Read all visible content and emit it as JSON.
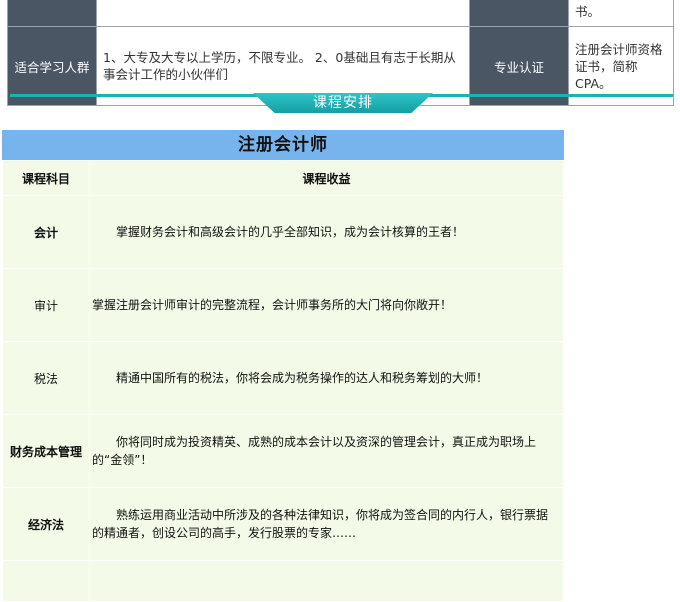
{
  "info_table": {
    "rows": [
      {
        "label_left": "",
        "value_left": "",
        "label_right": "",
        "value_right": "书。"
      },
      {
        "label_left": "适合学习人群",
        "value_left": "1、大专及大专以上学历，不限专业。 2、0基础且有志于长期从事会计工作的小伙伴们",
        "label_right": "专业认证",
        "value_right": "注册会计师资格证书，简称CPA。"
      }
    ]
  },
  "banner": {
    "title": "课程安排"
  },
  "course": {
    "title": "注册会计师",
    "headers": {
      "subject": "课程科目",
      "benefit": "课程收益"
    },
    "rows": [
      {
        "subject": "会计",
        "benefit": "掌握财务会计和高级会计的几乎全部知识，成为会计核算的王者！"
      },
      {
        "subject": "审计",
        "benefit": "掌握注册会计师审计的完整流程，会计师事务所的大门将向你敞开！"
      },
      {
        "subject": "税法",
        "benefit": "精通中国所有的税法，你将会成为税务操作的达人和税务筹划的大师！"
      },
      {
        "subject": "财务成本管理",
        "benefit": "你将同时成为投资精英、成熟的成本会计以及资深的管理会计，真正成为职场上的“金领”！"
      },
      {
        "subject": "经济法",
        "benefit": "熟练运用商业活动中所涉及的各种法律知识，你将成为签合同的内行人，银行票据的精通者，创设公司的高手，发行股票的专家……"
      },
      {
        "subject": "",
        "benefit": ""
      }
    ]
  },
  "colors": {
    "label_bg": "#4a5663",
    "banner_teal": "#19b3b3",
    "course_title_bg": "#77b3ec",
    "cell_bg": "#f3fbe8"
  }
}
